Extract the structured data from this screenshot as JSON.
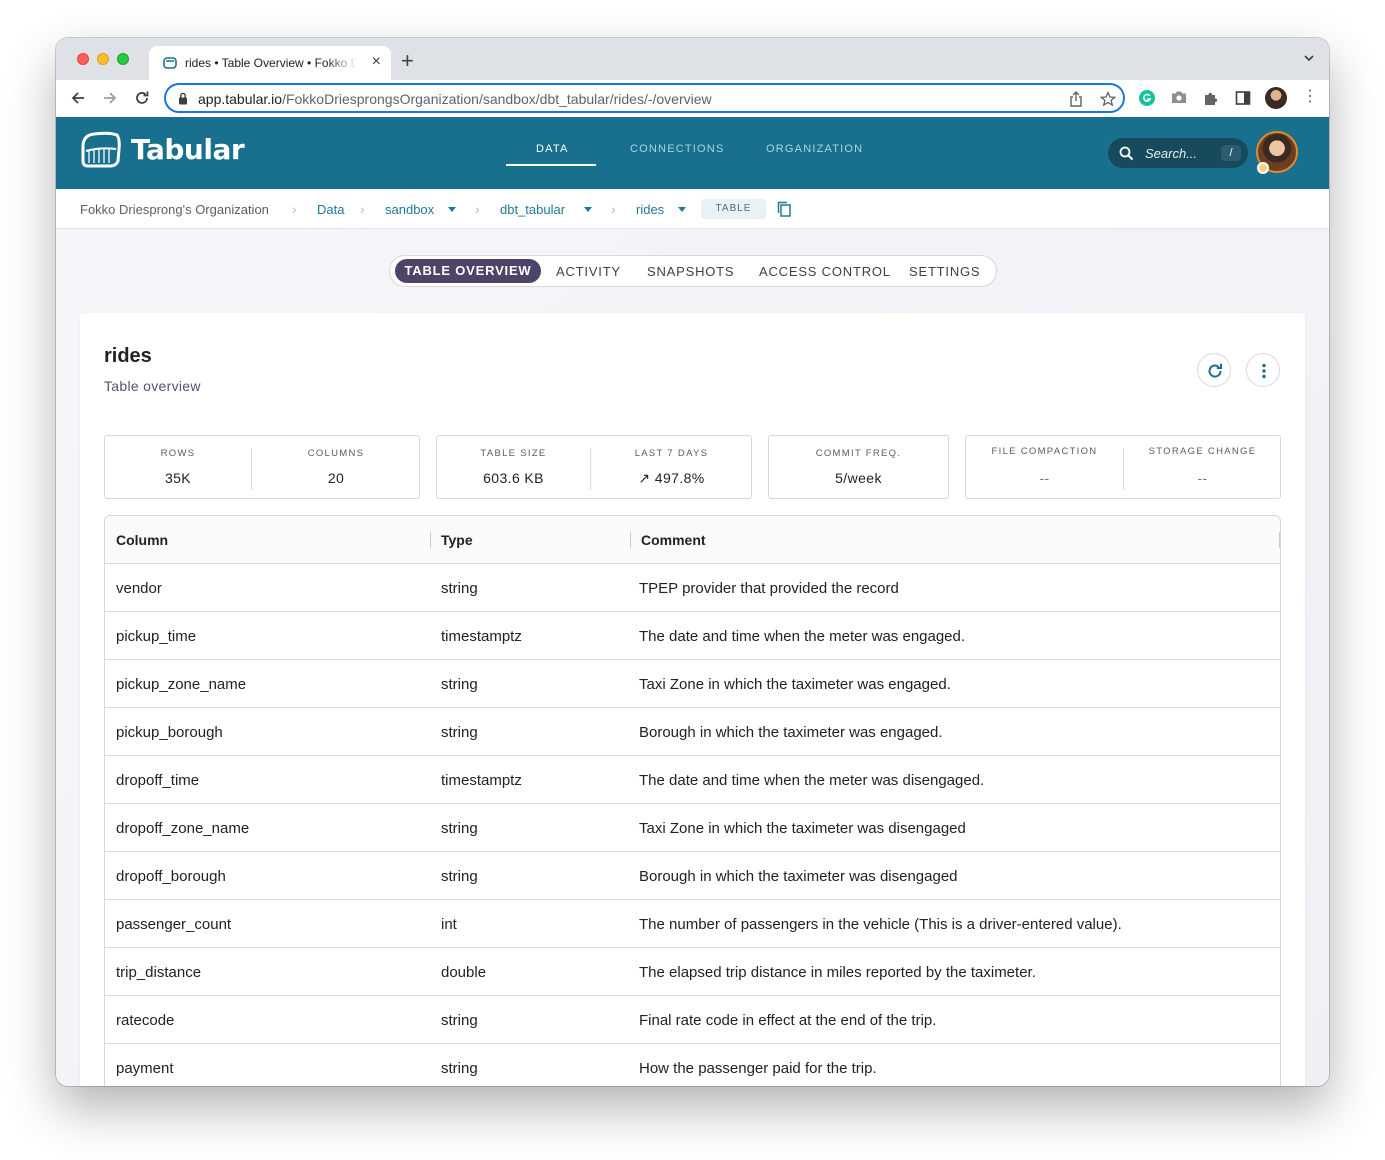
{
  "browser": {
    "tab_title": "rides • Table Overview • Fokko Driesprong",
    "url_host": "app.tabular.io",
    "url_path": "/FokkoDriesprongsOrganization/sandbox/dbt_tabular/rides/-/overview"
  },
  "app": {
    "logo_text": "Tabular",
    "nav": {
      "data": "DATA",
      "connections": "CONNECTIONS",
      "organization": "ORGANIZATION"
    },
    "search_placeholder": "Search...",
    "search_shortcut": "/"
  },
  "breadcrumb": {
    "org": "Fokko Driesprong's Organization",
    "data": "Data",
    "sandbox": "sandbox",
    "schema": "dbt_tabular",
    "table": "rides",
    "badge": "TABLE"
  },
  "subtabs": {
    "overview": "TABLE OVERVIEW",
    "activity": "ACTIVITY",
    "snapshots": "SNAPSHOTS",
    "access": "ACCESS CONTROL",
    "settings": "SETTINGS"
  },
  "card": {
    "title": "rides",
    "subtitle": "Table overview"
  },
  "stats": {
    "rows_label": "ROWS",
    "rows": "35K",
    "columns_label": "COLUMNS",
    "columns": "20",
    "size_label": "TABLE SIZE",
    "size": "603.6 KB",
    "last7_label": "LAST 7 DAYS",
    "last7": "↗ 497.8%",
    "commit_label": "COMMIT FREQ.",
    "commit": "5/week",
    "compaction_label": "FILE COMPACTION",
    "compaction": "--",
    "storage_label": "STORAGE CHANGE",
    "storage": "--"
  },
  "schema_table": {
    "headers": {
      "column": "Column",
      "type": "Type",
      "comment": "Comment"
    },
    "rows": [
      {
        "column": "vendor",
        "type": "string",
        "comment": "TPEP provider that provided the record"
      },
      {
        "column": "pickup_time",
        "type": "timestamptz",
        "comment": "The date and time when the meter was engaged."
      },
      {
        "column": "pickup_zone_name",
        "type": "string",
        "comment": "Taxi Zone in which the taximeter was engaged."
      },
      {
        "column": "pickup_borough",
        "type": "string",
        "comment": "Borough in which the taximeter was engaged."
      },
      {
        "column": "dropoff_time",
        "type": "timestamptz",
        "comment": "The date and time when the meter was disengaged."
      },
      {
        "column": "dropoff_zone_name",
        "type": "string",
        "comment": "Taxi Zone in which the taximeter was disengaged"
      },
      {
        "column": "dropoff_borough",
        "type": "string",
        "comment": "Borough in which the taximeter was disengaged"
      },
      {
        "column": "passenger_count",
        "type": "int",
        "comment": "The number of passengers in the vehicle (This is a driver-entered value)."
      },
      {
        "column": "trip_distance",
        "type": "double",
        "comment": "The elapsed trip distance in miles reported by the taximeter."
      },
      {
        "column": "ratecode",
        "type": "string",
        "comment": "Final rate code in effect at the end of the trip."
      },
      {
        "column": "payment",
        "type": "string",
        "comment": "How the passenger paid for the trip."
      }
    ]
  },
  "colors": {
    "header_bg": "#19708e",
    "accent_link": "#1f7a99",
    "active_tab": "#4d4467"
  }
}
